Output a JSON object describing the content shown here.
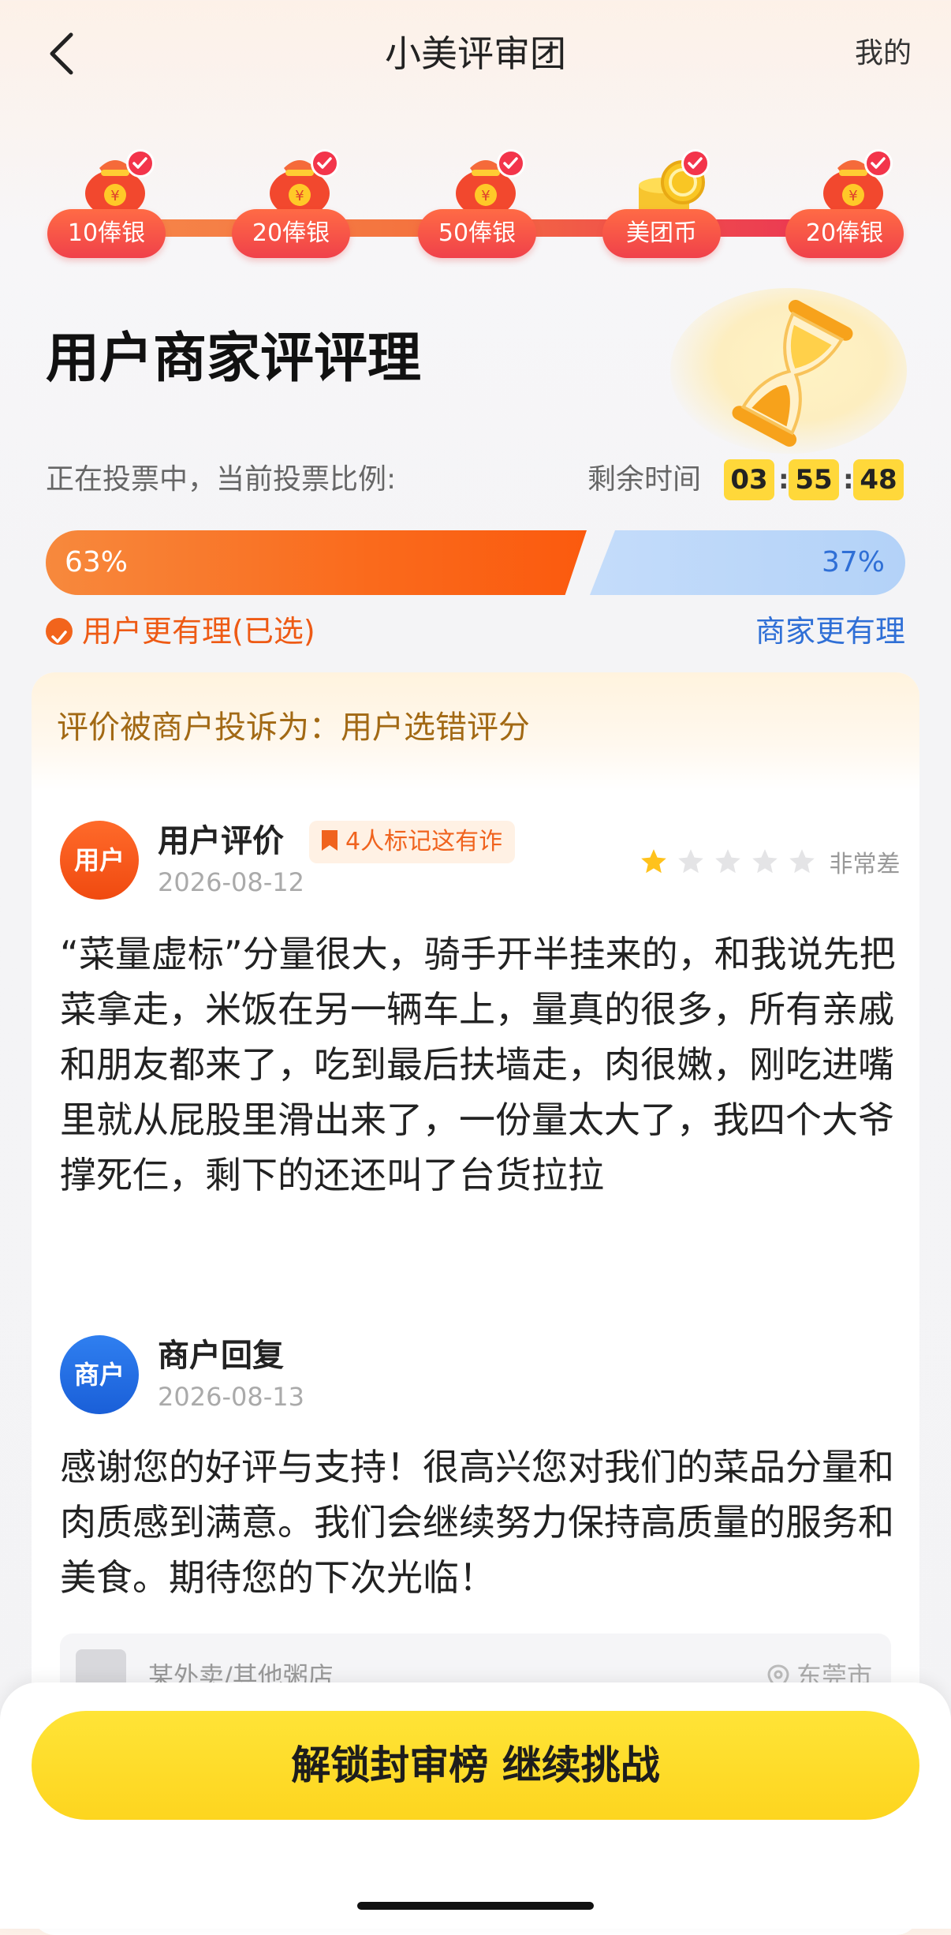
{
  "header": {
    "title": "小美评审团",
    "right_link": "我的"
  },
  "rewards": [
    {
      "label": "10俸银",
      "icon": "money-bag-icon",
      "done": true
    },
    {
      "label": "20俸银",
      "icon": "money-bag-icon",
      "done": true
    },
    {
      "label": "50俸银",
      "icon": "money-bag-icon",
      "done": true
    },
    {
      "label": "美团币",
      "icon": "coins-icon",
      "done": true
    },
    {
      "label": "20俸银",
      "icon": "money-bag-icon",
      "done": true
    }
  ],
  "topic": {
    "title": "用户商家评评理"
  },
  "vote": {
    "status": "正在投票中，当前投票比例:",
    "remaining_label": "剩余时间",
    "timer": {
      "h": "03",
      "m": "55",
      "s": "48"
    },
    "left_pct": "63%",
    "right_pct": "37%",
    "left_share": 0.63,
    "left_option": "用户更有理(已选)",
    "right_option": "商家更有理"
  },
  "card": {
    "complaint": "评价被商户投诉为：用户选错评分",
    "user": {
      "avatar": "用户",
      "title": "用户评价",
      "flag": "4人标记这有诈",
      "date": "2026-08-12",
      "rating": 1,
      "rating_max": 5,
      "rating_label": "非常差",
      "text": "“菜量虚标”分量很大，骑手开半挂来的，和我说先把菜拿走，米饭在另一辆车上，量真的很多，所有亲戚和朋友都来了，吃到最后扶墙走，肉很嫩，刚吃进嘴里就从屁股里滑出来了，一份量太大了，我四个大爷撑死仨，剩下的还还叫了台货拉拉"
    },
    "merchant": {
      "avatar": "商户",
      "title": "商户回复",
      "date": "2026-08-13",
      "text": "感谢您的好评与支持！很高兴您对我们的菜品分量和肉质感到满意。我们会继续努力保持高质量的服务和美食。期待您的下次光临！"
    },
    "shop": {
      "name": "某外卖/其他粥店",
      "location": "东莞市"
    }
  },
  "cta": {
    "label": "解锁封审榜 继续挑战"
  },
  "colors": {
    "accent_orange": "#fb5a0e",
    "accent_blue": "#2f6fd6",
    "cta_yellow": "#fdd51f",
    "reward_red": "#f0414a"
  }
}
